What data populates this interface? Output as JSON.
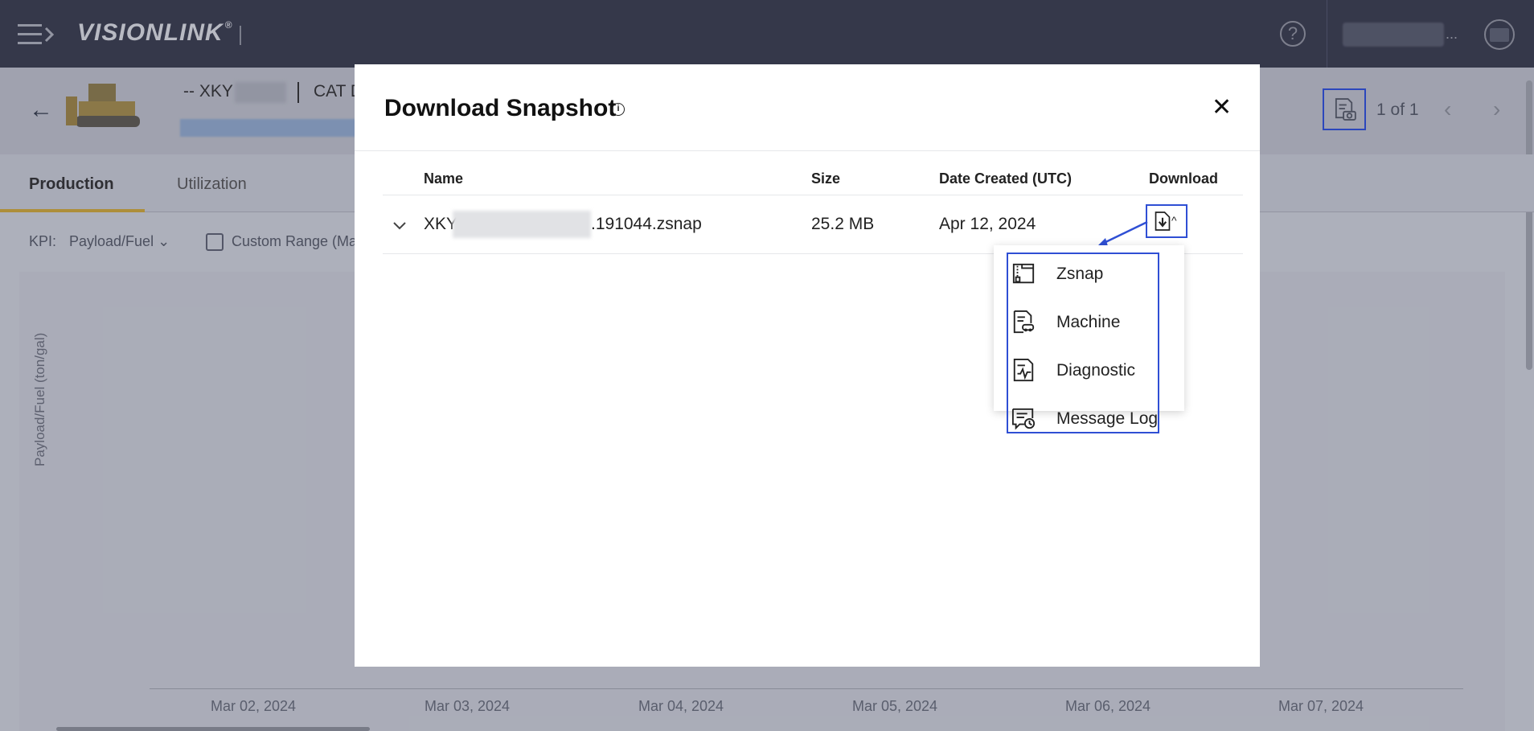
{
  "app": {
    "logo_text": "VISIONLINK",
    "logo_mark": "®",
    "user_ellipsis": "..."
  },
  "asset": {
    "prefix": "-- XKY",
    "model": "CAT D"
  },
  "pager": {
    "text": "1 of 1"
  },
  "tabs": [
    {
      "label": "Production"
    },
    {
      "label": "Utilization"
    }
  ],
  "filters": {
    "kpi_label": "KPI:",
    "kpi_value": "Payload/Fuel",
    "range_text": "Custom Range (Ma"
  },
  "chart": {
    "ylabel": "Payload/Fuel (ton/gal)",
    "x_ticks": [
      "Mar 02, 2024",
      "Mar 03, 2024",
      "Mar 04, 2024",
      "Mar 05, 2024",
      "Mar 06, 2024",
      "Mar 07, 2024"
    ]
  },
  "modal": {
    "title": "Download Snapshot",
    "info_glyph": "i",
    "close_glyph": "✕",
    "columns": {
      "name": "Name",
      "size": "Size",
      "date": "Date Created (UTC)",
      "download": "Download"
    },
    "rows": [
      {
        "name_prefix": "XKY",
        "name_suffix": ".191044.zsnap",
        "size": "25.2 MB",
        "date": "Apr 12, 2024"
      }
    ],
    "download_menu": [
      {
        "label": "Zsnap",
        "icon": "zip-file-icon"
      },
      {
        "label": "Machine",
        "icon": "machine-document-icon"
      },
      {
        "label": "Diagnostic",
        "icon": "diagnostic-document-icon"
      },
      {
        "label": "Message Log",
        "icon": "message-log-icon"
      }
    ]
  },
  "colors": {
    "accent": "#2f4fd4",
    "topbar": "#3a3d4d",
    "tab_underline": "#c9a43a"
  }
}
